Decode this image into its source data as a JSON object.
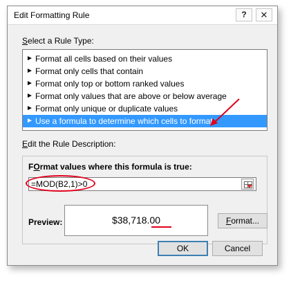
{
  "titlebar": {
    "title": "Edit Formatting Rule",
    "help_icon": "?",
    "close_icon": "✕"
  },
  "rule_type": {
    "label_underlined": "S",
    "label_rest": "elect a Rule Type:",
    "bullet": "►",
    "items": [
      {
        "label": "Format all cells based on their values",
        "selected": false
      },
      {
        "label": "Format only cells that contain",
        "selected": false
      },
      {
        "label": "Format only top or bottom ranked values",
        "selected": false
      },
      {
        "label": "Format only values that are above or below average",
        "selected": false
      },
      {
        "label": "Format only unique or duplicate values",
        "selected": false
      },
      {
        "label": "Use a formula to determine which cells to format",
        "selected": true
      }
    ]
  },
  "description": {
    "label_underlined": "E",
    "label_rest": "dit the Rule Description:",
    "formula_heading_underlined": "O",
    "formula_heading_pre": "F",
    "formula_heading_rest": "rmat values where this formula is true:",
    "formula_value": "=MOD(B2,1)>0",
    "preview_label": "Preview:",
    "preview_value": "$38,718.00",
    "format_button_underlined": "F",
    "format_button_rest": "ormat..."
  },
  "buttons": {
    "ok": "OK",
    "cancel": "Cancel"
  },
  "annotation_color": "#e0001b",
  "selection_color": "#3399ff"
}
